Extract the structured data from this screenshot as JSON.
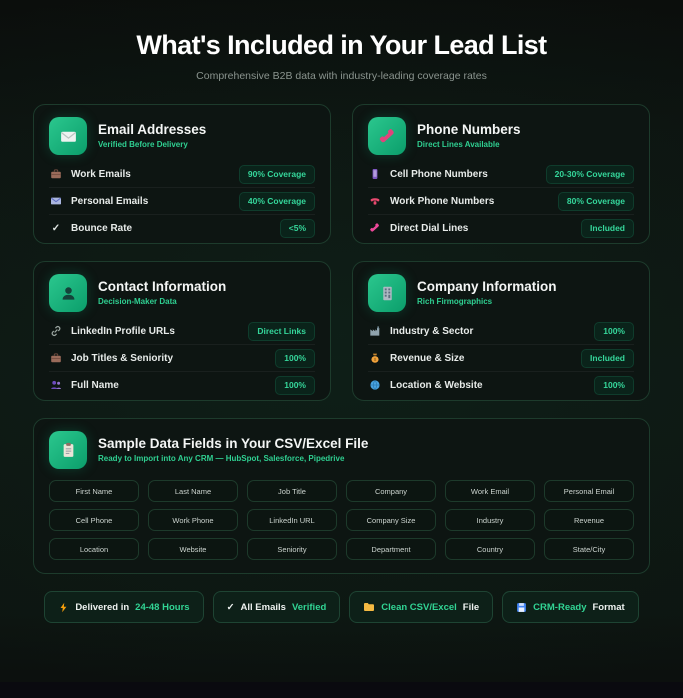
{
  "page": {
    "title": "What's Included in Your Lead List",
    "subtitle": "Comprehensive B2B data with industry-leading coverage rates"
  },
  "colors": {
    "accent_green": "#34d399",
    "tile_gradient_start": "#2bc78e",
    "tile_gradient_end": "#0b9e6b",
    "card_background": "#0d1512",
    "card_border": "#1d3b2c",
    "badge_background": "#0a231a",
    "page_background": "#0e1713",
    "footer_strip": "#0a0a0f"
  },
  "cards": [
    {
      "id": "email-addresses",
      "icon": "envelope-icon",
      "title": "Email Addresses",
      "subtitle": "Verified Before Delivery",
      "rows": [
        {
          "icon": "briefcase-icon",
          "label": "Work Emails",
          "badge": "90% Coverage"
        },
        {
          "icon": "email-icon",
          "label": "Personal Emails",
          "badge": "40% Coverage"
        },
        {
          "icon": "check-icon",
          "check_glyph": "✓",
          "label": "Bounce Rate",
          "badge": "<5%"
        }
      ]
    },
    {
      "id": "phone-numbers",
      "icon": "phone-receiver-icon",
      "title": "Phone Numbers",
      "subtitle": "Direct Lines Available",
      "rows": [
        {
          "icon": "mobile-phone-icon",
          "label": "Cell Phone Numbers",
          "badge": "20-30% Coverage"
        },
        {
          "icon": "telephone-icon",
          "label": "Work Phone Numbers",
          "badge": "80% Coverage"
        },
        {
          "icon": "dial-phone-icon",
          "label": "Direct Dial Lines",
          "badge": "Included"
        }
      ]
    },
    {
      "id": "contact-information",
      "icon": "person-icon",
      "title": "Contact Information",
      "subtitle": "Decision-Maker Data",
      "rows": [
        {
          "icon": "link-icon",
          "label": "LinkedIn Profile URLs",
          "badge": "Direct Links"
        },
        {
          "icon": "briefcase-icon",
          "label": "Job Titles & Seniority",
          "badge": "100%"
        },
        {
          "icon": "people-icon",
          "label": "Full Name",
          "badge": "100%"
        }
      ]
    },
    {
      "id": "company-information",
      "icon": "building-icon",
      "title": "Company Information",
      "subtitle": "Rich Firmographics",
      "rows": [
        {
          "icon": "factory-icon",
          "label": "Industry & Sector",
          "badge": "100%"
        },
        {
          "icon": "money-bag-icon",
          "label": "Revenue & Size",
          "badge": "Included"
        },
        {
          "icon": "globe-icon",
          "label": "Location & Website",
          "badge": "100%"
        }
      ]
    }
  ],
  "sample_card": {
    "icon": "clipboard-icon",
    "title": "Sample Data Fields in Your CSV/Excel File",
    "subtitle": "Ready to Import into Any CRM — HubSpot, Salesforce, Pipedrive",
    "fields": [
      "First Name",
      "Last Name",
      "Job Title",
      "Company",
      "Work Email",
      "Personal Email",
      "Cell Phone",
      "Work Phone",
      "LinkedIn URL",
      "Company Size",
      "Industry",
      "Revenue",
      "Location",
      "Website",
      "Seniority",
      "Department",
      "Country",
      "State/City"
    ]
  },
  "footer_badges": [
    {
      "icon": "lightning-icon",
      "white": "Delivered in",
      "green": "24-48 Hours"
    },
    {
      "icon": "check-icon",
      "check_glyph": "✓",
      "white": "All Emails",
      "green": "Verified"
    },
    {
      "icon": "folder-icon",
      "green": "Clean CSV/Excel",
      "white": "File"
    },
    {
      "icon": "floppy-icon",
      "green": "CRM-Ready",
      "white": "Format"
    }
  ]
}
